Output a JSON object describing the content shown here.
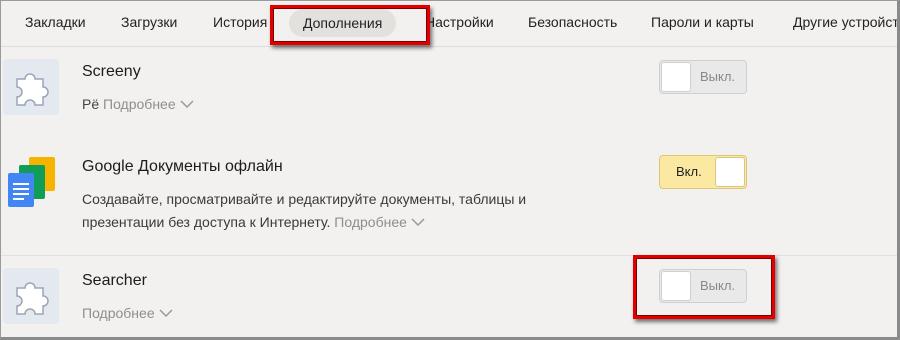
{
  "tabs": [
    {
      "label": "Закладки"
    },
    {
      "label": "Загрузки"
    },
    {
      "label": "История"
    },
    {
      "label": "Дополнения",
      "active": true
    },
    {
      "label": "Настройки"
    },
    {
      "label": "Безопасность"
    },
    {
      "label": "Пароли и карты"
    },
    {
      "label": "Другие устройства"
    }
  ],
  "extensions": [
    {
      "name": "Screeny",
      "prefix": "Рё",
      "more_label": "Подробнее",
      "icon": "puzzle-icon",
      "toggle": {
        "state": "off",
        "label": "Выкл."
      }
    },
    {
      "name": "Google Документы офлайн",
      "description_line1": "Создавайте, просматривайте и редактируйте документы, таблицы и",
      "description_line2": "презентации без доступа к Интернету.",
      "more_label": "Подробнее",
      "icon": "google-docs-icon",
      "toggle": {
        "state": "on",
        "label": "Вкл."
      }
    },
    {
      "name": "Searcher",
      "more_label": "Подробнее",
      "icon": "puzzle-icon",
      "toggle": {
        "state": "off",
        "label": "Выкл."
      }
    }
  ],
  "colors": {
    "highlight": "#e00000",
    "toggle_on": "#fbe9a2",
    "background": "#f2f1ef"
  }
}
